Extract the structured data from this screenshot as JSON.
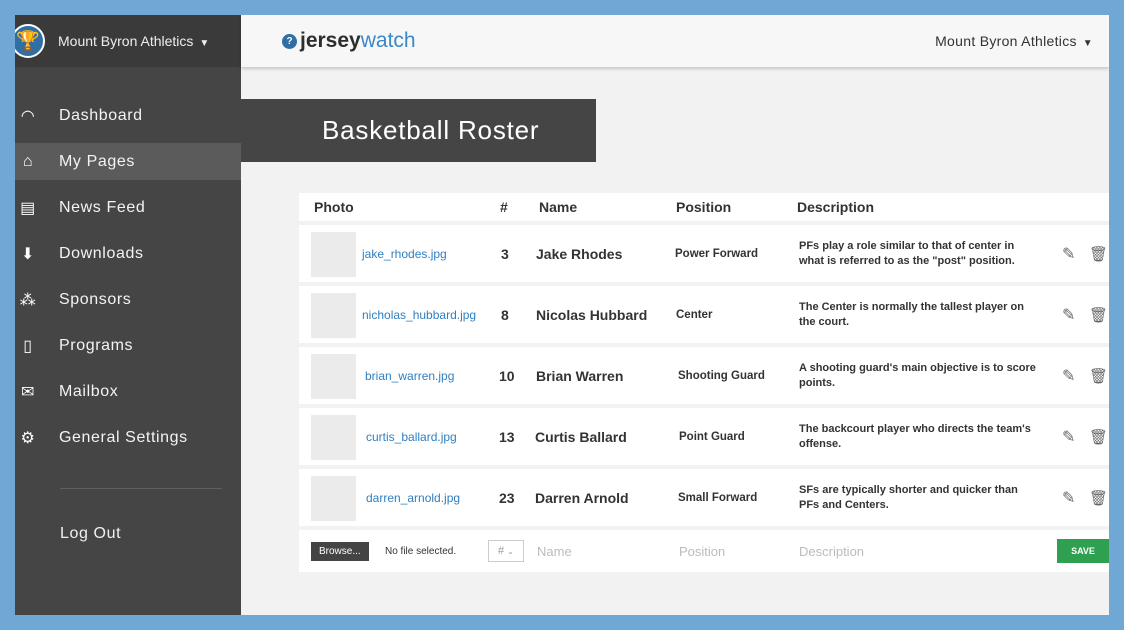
{
  "sidebar": {
    "org_name": "Mount Byron Athletics",
    "items": [
      {
        "label": "Dashboard",
        "icon": "gauge-icon"
      },
      {
        "label": "My Pages",
        "icon": "home-icon"
      },
      {
        "label": "News Feed",
        "icon": "newspaper-icon"
      },
      {
        "label": "Downloads",
        "icon": "download-icon"
      },
      {
        "label": "Sponsors",
        "icon": "sponsors-icon"
      },
      {
        "label": "Programs",
        "icon": "document-icon"
      },
      {
        "label": "Mailbox",
        "icon": "mail-icon"
      },
      {
        "label": "General Settings",
        "icon": "gear-icon"
      }
    ],
    "logout_label": "Log Out"
  },
  "header": {
    "logo_jersey": "jersey",
    "logo_watch": "watch",
    "account_name": "Mount Byron Athletics"
  },
  "page": {
    "title": "Basketball Roster"
  },
  "table": {
    "headers": {
      "photo": "Photo",
      "num": "#",
      "name": "Name",
      "position": "Position",
      "description": "Description"
    },
    "rows": [
      {
        "file": "jake_rhodes.jpg",
        "num": "3",
        "name": "Jake Rhodes",
        "position": "Power Forward",
        "description": "PFs play a role similar to that of center in what is referred to as the \"post\" position."
      },
      {
        "file": "nicholas_hubbard.jpg",
        "num": "8",
        "name": "Nicolas Hubbard",
        "position": "Center",
        "description": "The Center is normally the tallest player on the court."
      },
      {
        "file": "brian_warren.jpg",
        "num": "10",
        "name": "Brian Warren",
        "position": "Shooting Guard",
        "description": "A shooting guard's main objective is to score points."
      },
      {
        "file": "curtis_ballard.jpg",
        "num": "13",
        "name": "Curtis Ballard",
        "position": "Point Guard",
        "description": "The backcourt player who directs the team's offense."
      },
      {
        "file": "darren_arnold.jpg",
        "num": "23",
        "name": "Darren Arnold",
        "position": "Small Forward",
        "description": "SFs are typically shorter and quicker than PFs and Centers."
      }
    ]
  },
  "add_row": {
    "browse_label": "Browse...",
    "no_file": "No file selected.",
    "num_placeholder": "#",
    "name_placeholder": "Name",
    "position_placeholder": "Position",
    "description_placeholder": "Description",
    "save_label": "SAVE"
  },
  "colors": {
    "accent": "#3a87c9",
    "sidebar_bg": "#454545",
    "save_green": "#2ea04f",
    "frame_border": "#6fa8d4"
  }
}
